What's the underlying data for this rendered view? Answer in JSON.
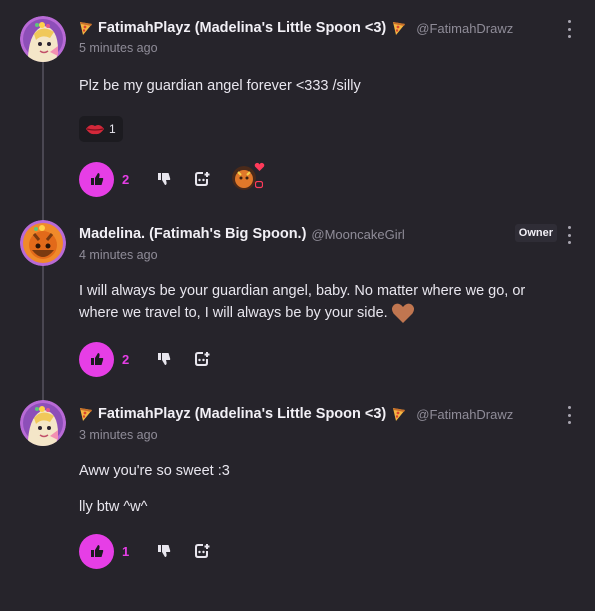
{
  "comments": [
    {
      "author": "FatimahPlayz (Madelina's Little Spoon <3)",
      "handle": "@FatimahDrawz",
      "time": "5 minutes ago",
      "paragraphs": [
        "Plz be my guardian angel forever <333 /silly"
      ],
      "reaction": {
        "emoji": "kiss-lips",
        "count": "1"
      },
      "likes": "2",
      "has_creator_heart": true
    },
    {
      "author": "Madelina. (Fatimah's Big Spoon.)",
      "handle": "@MooncakeGirl",
      "badge": "Owner",
      "time": "4 minutes ago",
      "paragraphs": [
        "I will always be your guardian angel, baby. No matter where we go, or where we travel to, I will always be by your side."
      ],
      "likes": "2"
    },
    {
      "author": "FatimahPlayz (Madelina's Little Spoon <3)",
      "handle": "@FatimahDrawz",
      "time": "3 minutes ago",
      "paragraphs": [
        "Aww you're so sweet :3",
        "lly btw ^w^"
      ],
      "likes": "1"
    }
  ],
  "colors": {
    "background": "#26242b",
    "accent": "#e63ee6",
    "muted": "#8f8c98"
  }
}
